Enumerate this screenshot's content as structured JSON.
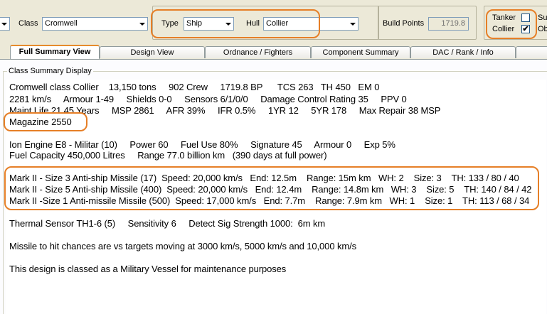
{
  "toolbar": {
    "class_label": "Class",
    "class_value": "Cromwell",
    "type_label": "Type",
    "type_value": "Ship",
    "hull_label": "Hull",
    "hull_value": "Collier",
    "build_points_label": "Build Points",
    "build_points_value": "1719.8",
    "tanker_label": "Tanker",
    "collier_label": "Collier",
    "tanker_checked": false,
    "collier_checked": true,
    "collier_check_glyph": "✔",
    "cut_label_1": "Su",
    "cut_label_2": "Ob"
  },
  "tabs": [
    {
      "label": "Full Summary View",
      "active": true
    },
    {
      "label": "Design View"
    },
    {
      "label": "Ordnance / Fighters"
    },
    {
      "label": "Component Summary"
    },
    {
      "label": "DAC / Rank / Info"
    }
  ],
  "summary": {
    "frame_title": "Class Summary Display",
    "lines": [
      "Cromwell class Collier    13,150 tons     902 Crew     1719.8 BP      TCS 263   TH 450   EM 0",
      "2281 km/s     Armour 1-49     Shields 0-0     Sensors 6/1/0/0     Damage Control Rating 35     PPV 0",
      "Maint Life 21.45 Years     MSP 2861     AFR 39%     IFR 0.5%     1YR 12     5YR 178     Max Repair 38 MSP",
      "Magazine 2550",
      "Ion Engine E8 - Militar (10)     Power 60     Fuel Use 80%     Signature 45     Armour 0     Exp 5%",
      "Fuel Capacity 450,000 Litres     Range 77.0 billion km   (390 days at full power)",
      "Mark II - Size 3 Anti-ship Missile (17)  Speed: 20,000 km/s   End: 12.5m    Range: 15m km   WH: 2    Size: 3    TH: 133 / 80 / 40",
      "Mark II - Size 5 Anti-ship Missile (400)  Speed: 20,000 km/s   End: 12.4m    Range: 14.8m km   WH: 3    Size: 5    TH: 140 / 84 / 42",
      "Mark II -Size 1 Anti-missile Missile (500)  Speed: 17,000 km/s   End: 7.7m    Range: 7.9m km   WH: 1    Size: 1    TH: 113 / 68 / 34",
      "Thermal Sensor TH1-6 (5)     Sensitivity 6     Detect Sig Strength 1000:  6m km",
      "Missile to hit chances are vs targets moving at 3000 km/s, 5000 km/s and 10,000 km/s",
      "This design is classed as a Military Vessel for maintenance purposes"
    ]
  },
  "colors": {
    "highlight": "#e67f27",
    "window_bg": "#ece9d8",
    "content_bg": "#ffffff"
  }
}
